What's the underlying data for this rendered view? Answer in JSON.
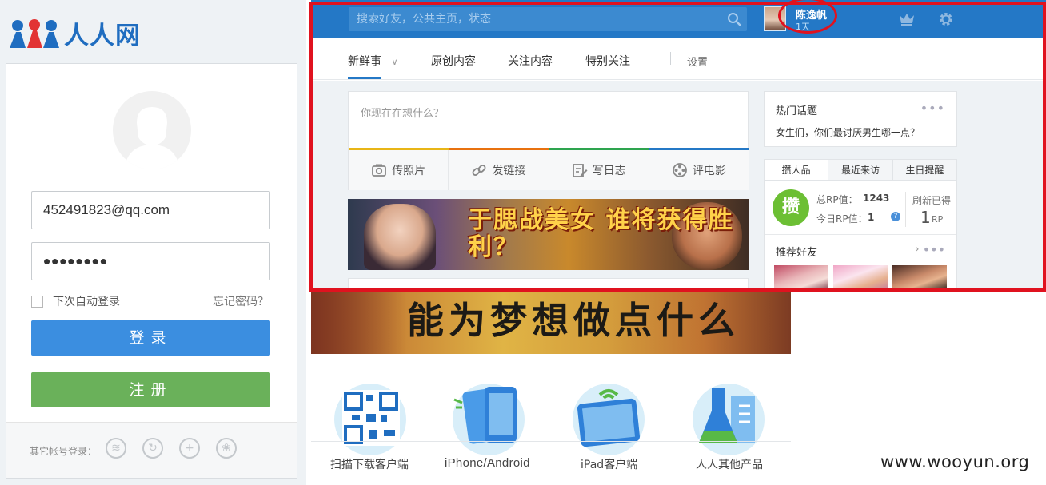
{
  "logo": {
    "text": "人人网"
  },
  "login": {
    "email_value": "452491823@qq.com",
    "password_value": "••••••••",
    "remember_label": "下次自动登录",
    "forgot_label": "忘记密码？",
    "login_button": "登录",
    "register_button": "注册",
    "other_accounts_label": "其它帐号登录：",
    "other_account_icons": [
      "weibo-icon",
      "tianyi-icon",
      "plus-icon",
      "baidu-paw-icon"
    ]
  },
  "topbar": {
    "search_placeholder": "搜索好友，公共主页，状态",
    "user_name": "陈逸帆",
    "user_days": "1天",
    "icons": [
      "search-icon",
      "crown-icon",
      "gear-icon"
    ]
  },
  "nav": {
    "items": [
      "新鲜事",
      "原创内容",
      "关注内容",
      "特别关注"
    ],
    "settings_label": "设置",
    "active_index": 0
  },
  "composer": {
    "placeholder": "你现在在想什么？",
    "actions": [
      "传照片",
      "发链接",
      "写日志",
      "评电影"
    ],
    "color_bar": [
      "#e8b517",
      "#e8710f",
      "#2ea44f",
      "#2478c6"
    ]
  },
  "banner_top": {
    "text": "于腮战美女 谁将获得胜利？"
  },
  "hot_topics": {
    "title": "热门话题",
    "topic": "女生们，你们最讨厌男生哪一点？"
  },
  "rp_panel": {
    "tabs": [
      "攒人品",
      "最近来访",
      "生日提醒"
    ],
    "badge": "攒",
    "total_label": "总RP值：",
    "total_value": "1243",
    "today_label": "今日RP值：",
    "today_value": "1",
    "refresh_label": "刷新已得",
    "refresh_value": "1",
    "refresh_unit": "RP"
  },
  "recommend": {
    "title": "推荐好友",
    "arrow": "›"
  },
  "banner_bottom": {
    "text": "能为梦想做点什么"
  },
  "apps": [
    {
      "label": "扫描下载客户端",
      "icon": "qr-code-icon"
    },
    {
      "label": "iPhone/Android",
      "icon": "phones-icon"
    },
    {
      "label": "iPad客户端",
      "icon": "tablet-icon"
    },
    {
      "label": "人人其他产品",
      "icon": "flask-icon"
    }
  ],
  "watermark": "www.wooyun.org",
  "colors": {
    "brand_blue": "#2478c6",
    "login_blue": "#3b8ee0",
    "register_green": "#6ab15a",
    "highlight_red": "#e0121f"
  }
}
